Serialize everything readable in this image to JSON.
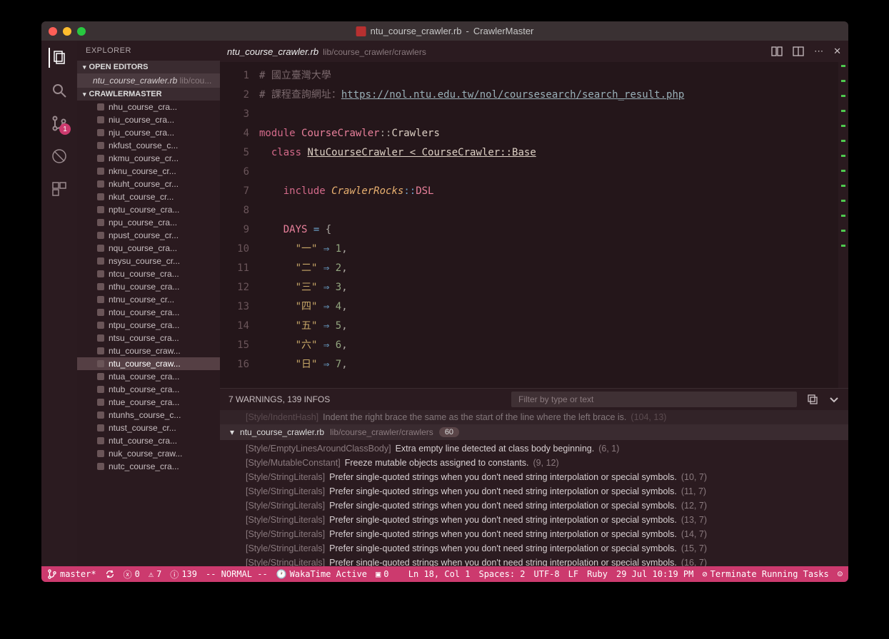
{
  "titlebar": {
    "filename": "ntu_course_crawler.rb",
    "project": "CrawlerMaster"
  },
  "activity_bar": {
    "scm_badge": "1"
  },
  "sidebar": {
    "title": "EXPLORER",
    "open_editors_label": "OPEN EDITORS",
    "open_editor": {
      "name": "ntu_course_crawler.rb",
      "path": "lib/cou..."
    },
    "project_label": "CRAWLERMASTER",
    "files": [
      "nhu_course_cra...",
      "niu_course_cra...",
      "nju_course_cra...",
      "nkfust_course_c...",
      "nkmu_course_cr...",
      "nknu_course_cr...",
      "nkuht_course_cr...",
      "nkut_course_cr...",
      "nptu_course_cra...",
      "npu_course_cra...",
      "npust_course_cr...",
      "nqu_course_cra...",
      "nsysu_course_cr...",
      "ntcu_course_cra...",
      "nthu_course_cra...",
      "ntnu_course_cr...",
      "ntou_course_cra...",
      "ntpu_course_cra...",
      "ntsu_course_cra...",
      "ntu_course_craw...",
      "ntu_course_craw...",
      "ntua_course_cra...",
      "ntub_course_cra...",
      "ntue_course_cra...",
      "ntunhs_course_c...",
      "ntust_course_cr...",
      "ntut_course_cra...",
      "nuk_course_craw...",
      "nutc_course_cra..."
    ],
    "selected_index": 20
  },
  "tab": {
    "name": "ntu_course_crawler.rb",
    "path": "lib/course_crawler/crawlers"
  },
  "code": {
    "comment1": "# 國立臺灣大學",
    "comment2_prefix": "# 課程查詢網址：",
    "comment2_url": "https://nol.ntu.edu.tw/nol/coursesearch/search_result.php",
    "module_kw": "module",
    "module_name": "CourseCrawler",
    "module_sep": "::",
    "module_sub": "Crawlers",
    "class_kw": "class",
    "class_name": "NtuCourseCrawler < CourseCrawler::Base",
    "include_kw": "include",
    "include_mod": "CrawlerRocks",
    "include_dsl": "DSL",
    "days_const": "DAYS",
    "days_eq": "=",
    "brace_open": "{",
    "day_keys": [
      "\"一\"",
      "\"二\"",
      "\"三\"",
      "\"四\"",
      "\"五\"",
      "\"六\"",
      "\"日\""
    ],
    "day_arrow": "⇒",
    "day_vals": [
      "1",
      "2",
      "3",
      "4",
      "5",
      "6",
      "7"
    ],
    "comma": ","
  },
  "problems": {
    "summary": "7 WARNINGS, 139 INFOS",
    "filter_placeholder": "Filter by type or text",
    "faded_rule": "[Style/IndentHash]",
    "faded_msg": "Indent the right brace the same as the start of the line where the left brace is.",
    "faded_loc": "(104, 13)",
    "file_header": {
      "name": "ntu_course_crawler.rb",
      "path": "lib/course_crawler/crawlers",
      "count": "60"
    },
    "items": [
      {
        "rule": "[Style/EmptyLinesAroundClassBody]",
        "msg": "Extra empty line detected at class body beginning.",
        "loc": "(6, 1)"
      },
      {
        "rule": "[Style/MutableConstant]",
        "msg": "Freeze mutable objects assigned to constants.",
        "loc": "(9, 12)"
      },
      {
        "rule": "[Style/StringLiterals]",
        "msg": "Prefer single-quoted strings when you don't need string interpolation or special symbols.",
        "loc": "(10, 7)"
      },
      {
        "rule": "[Style/StringLiterals]",
        "msg": "Prefer single-quoted strings when you don't need string interpolation or special symbols.",
        "loc": "(11, 7)"
      },
      {
        "rule": "[Style/StringLiterals]",
        "msg": "Prefer single-quoted strings when you don't need string interpolation or special symbols.",
        "loc": "(12, 7)"
      },
      {
        "rule": "[Style/StringLiterals]",
        "msg": "Prefer single-quoted strings when you don't need string interpolation or special symbols.",
        "loc": "(13, 7)"
      },
      {
        "rule": "[Style/StringLiterals]",
        "msg": "Prefer single-quoted strings when you don't need string interpolation or special symbols.",
        "loc": "(14, 7)"
      },
      {
        "rule": "[Style/StringLiterals]",
        "msg": "Prefer single-quoted strings when you don't need string interpolation or special symbols.",
        "loc": "(15, 7)"
      },
      {
        "rule": "[Style/StringLiterals]",
        "msg": "Prefer single-quoted strings when you don't need string interpolation or special symbols.",
        "loc": "(16, 7)"
      }
    ]
  },
  "status": {
    "branch": "master*",
    "err": "0",
    "warn": "7",
    "info": "139",
    "mode": "-- NORMAL --",
    "waka": "WakaTime Active",
    "tabs": "0",
    "cursor": "Ln 18, Col 1",
    "spaces": "Spaces: 2",
    "encoding": "UTF-8",
    "eol": "LF",
    "lang": "Ruby",
    "time": "29 Jul 10:19 PM",
    "terminate": "Terminate Running Tasks"
  }
}
